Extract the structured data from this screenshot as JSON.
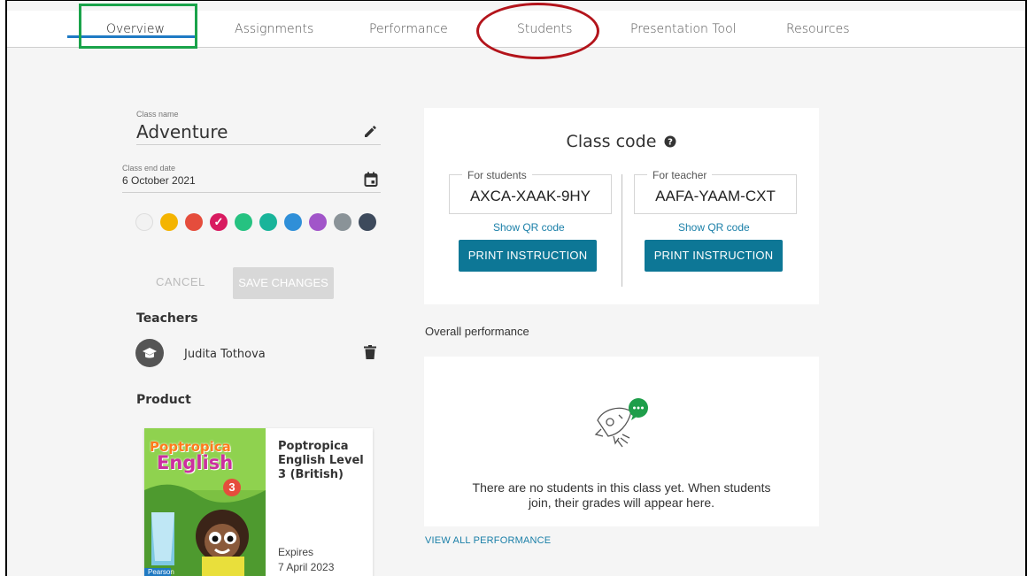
{
  "nav": {
    "tabs": [
      {
        "label": "Overview"
      },
      {
        "label": "Assignments"
      },
      {
        "label": "Performance"
      },
      {
        "label": "Students"
      },
      {
        "label": "Presentation Tool"
      },
      {
        "label": "Resources"
      }
    ],
    "active": "Overview"
  },
  "class_form": {
    "name_label": "Class name",
    "name_value": "Adventure",
    "end_date_label": "Class end date",
    "end_date_value": "6 October 2021",
    "colors": [
      "#f2f2f2",
      "#f4b400",
      "#e54d3c",
      "#d81b60",
      "#26c281",
      "#19b49a",
      "#2f8fd8",
      "#a155c9",
      "#8a9398",
      "#3d4a5c"
    ],
    "selected_color": "#d81b60",
    "cancel_label": "CANCEL",
    "save_label": "SAVE CHANGES"
  },
  "teachers": {
    "heading": "Teachers",
    "items": [
      {
        "name": "Judita Tothova"
      }
    ]
  },
  "product": {
    "heading": "Product",
    "title": "Poptropica English Level 3 (British)",
    "cover_brand": "Poptropica",
    "cover_subtitle": "English",
    "cover_level": "3",
    "cover_publisher": "Pearson",
    "expires_label": "Expires",
    "expires_date": "7 April 2023"
  },
  "class_code": {
    "title": "Class code",
    "students": {
      "label": "For students",
      "code": "AXCA-XAAK-9HY",
      "qr_label": "Show QR code",
      "print_label": "PRINT INSTRUCTION"
    },
    "teacher": {
      "label": "For teacher",
      "code": "AAFA-YAAM-CXT",
      "qr_label": "Show QR code",
      "print_label": "PRINT INSTRUCTION"
    }
  },
  "performance": {
    "heading": "Overall performance",
    "empty_message_line1": "There are no students in this class yet. When students",
    "empty_message_line2": "join, their grades will appear here.",
    "view_all_label": "VIEW ALL PERFORMANCE"
  },
  "colors": {
    "accent": "#0d7796",
    "link": "#1a7fa8",
    "tab_underline": "#1e7ac4",
    "annotation_green": "#1aa34a",
    "annotation_red": "#b3141b"
  }
}
